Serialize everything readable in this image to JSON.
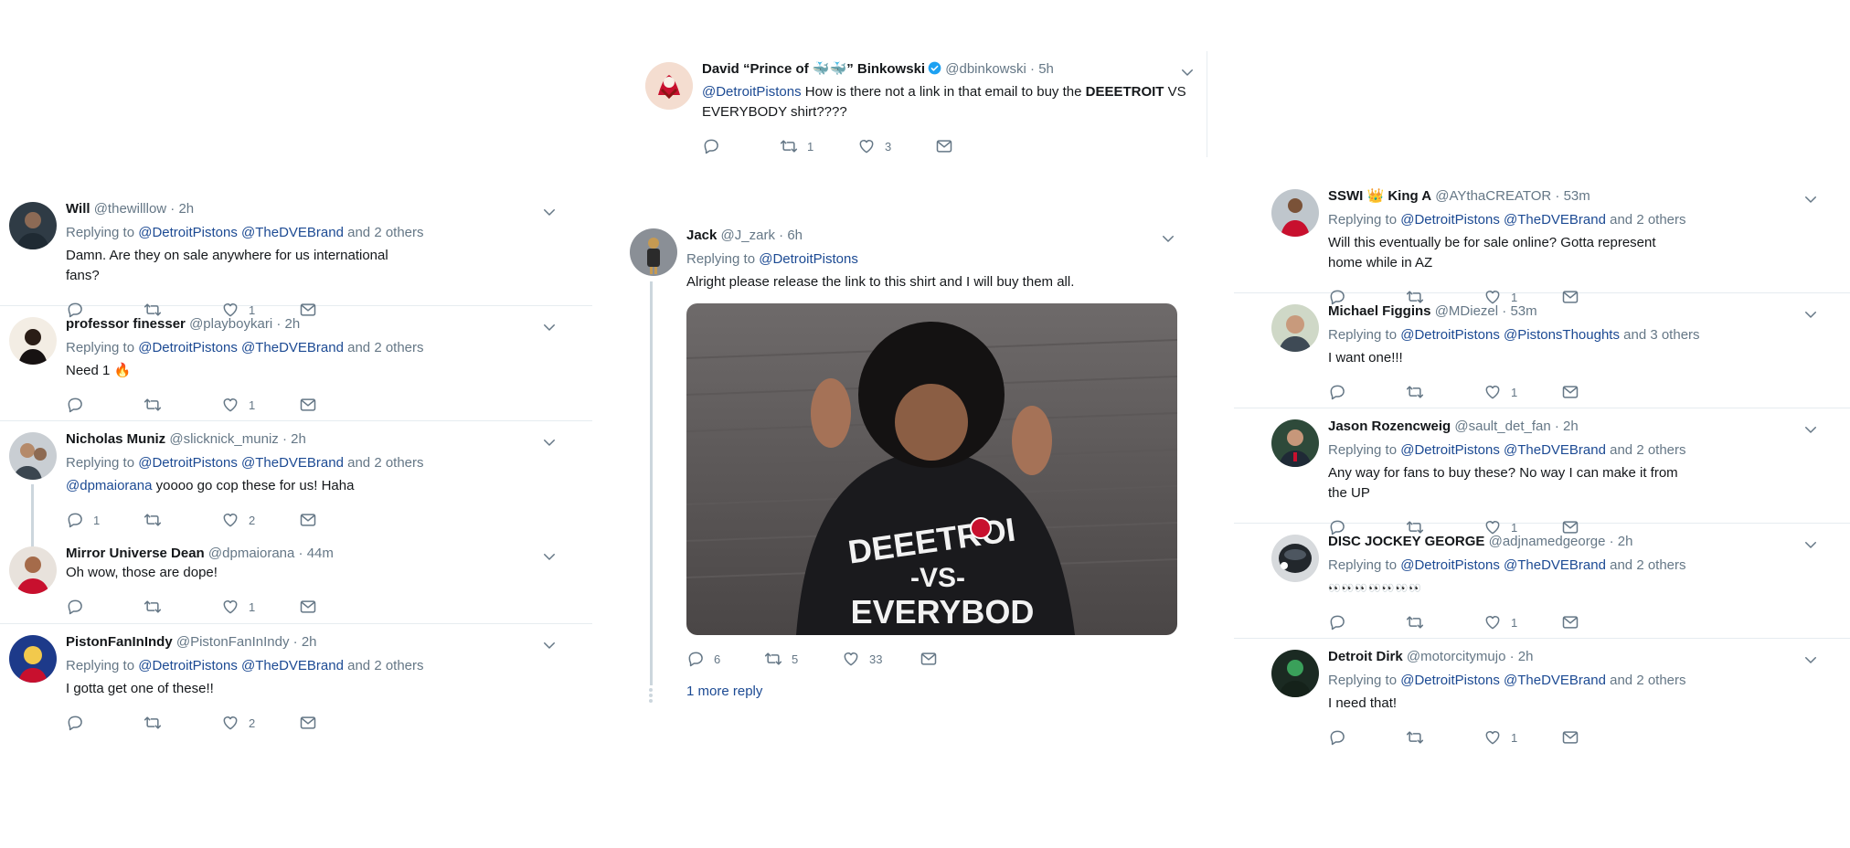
{
  "top_tweet": {
    "name": "David “Prince of 🐳🐳” Binkowski",
    "handle": "@dbinkowski",
    "time": "5h",
    "mention": "@DetroitPistons",
    "text_a": " How is there not a link in that email to buy the ",
    "text_bold": "DEEETROIT",
    "text_b": " VS EVERYBODY shirt????",
    "reply_count": "",
    "retweet_count": "1",
    "like_count": "3"
  },
  "left_column": [
    {
      "name": "Will",
      "handle": "@thewilllow",
      "time": "2h",
      "reply_to_1": "@DetroitPistons",
      "reply_to_2": "@TheDVEBrand",
      "reply_rest": "and 2 others",
      "text": "Damn. Are they on sale anywhere for us international fans?",
      "replies": "",
      "retweets": "",
      "likes": "1"
    },
    {
      "name": "professor finesser",
      "handle": "@playboykari",
      "time": "2h",
      "reply_to_1": "@DetroitPistons",
      "reply_to_2": "@TheDVEBrand",
      "reply_rest": "and 2 others",
      "text": "Need 1 🔥",
      "replies": "",
      "retweets": "",
      "likes": "1"
    },
    {
      "name": "Nicholas Muniz",
      "handle": "@slicknick_muniz",
      "time": "2h",
      "reply_to_1": "@DetroitPistons",
      "reply_to_2": "@TheDVEBrand",
      "reply_rest": "and 2 others",
      "text_mention": "@dpmaiorana",
      "text": " yoooo go cop these for us! Haha",
      "replies": "1",
      "retweets": "",
      "likes": "2"
    },
    {
      "name": "Mirror Universe Dean",
      "handle": "@dpmaiorana",
      "time": "44m",
      "text": "Oh wow, those are dope!",
      "replies": "",
      "retweets": "",
      "likes": "1"
    },
    {
      "name": "PistonFanInIndy",
      "handle": "@PistonFanInIndy",
      "time": "2h",
      "reply_to_1": "@DetroitPistons",
      "reply_to_2": "@TheDVEBrand",
      "reply_rest": "and 2 others",
      "text": "I gotta get one of these!!",
      "replies": "",
      "retweets": "",
      "likes": "2"
    }
  ],
  "center_tweet": {
    "name": "Jack",
    "handle": "@J_zark",
    "time": "6h",
    "reply_to_1": "@DetroitPistons",
    "text": "Alright please release the link to this shirt and I will buy them all.",
    "shirt_text_1": "DEEETROI",
    "shirt_text_2": "-VS-",
    "shirt_text_3": "EVERYBOD",
    "replies": "6",
    "retweets": "5",
    "likes": "33",
    "more_reply": "1 more reply"
  },
  "right_column": [
    {
      "name": "SSWI 👑 King A",
      "handle": "@AYthaCREATOR",
      "time": "53m",
      "reply_to_1": "@DetroitPistons",
      "reply_to_2": "@TheDVEBrand",
      "reply_rest": "and 2 others",
      "text": "Will this eventually be for sale online? Gotta represent home while in AZ",
      "replies": "",
      "retweets": "",
      "likes": "1"
    },
    {
      "name": "Michael Figgins",
      "handle": "@MDiezel",
      "time": "53m",
      "reply_to_1": "@DetroitPistons",
      "reply_to_2": "@PistonsThoughts",
      "reply_rest": "and 3 others",
      "text": "I want one!!!",
      "replies": "",
      "retweets": "",
      "likes": "1"
    },
    {
      "name": "Jason Rozencweig",
      "handle": "@sault_det_fan",
      "time": "2h",
      "reply_to_1": "@DetroitPistons",
      "reply_to_2": "@TheDVEBrand",
      "reply_rest": "and 2 others",
      "text": "Any way for fans to buy these? No way I can make it from the UP",
      "replies": "",
      "retweets": "",
      "likes": "1"
    },
    {
      "name": "DISC JOCKEY GEORGE",
      "handle": "@adjnamedgeorge",
      "time": "2h",
      "reply_to_1": "@DetroitPistons",
      "reply_to_2": "@TheDVEBrand",
      "reply_rest": "and 2 others",
      "text": "👀👀👀👀👀👀👀",
      "replies": "",
      "retweets": "",
      "likes": "1"
    },
    {
      "name": "Detroit Dirk",
      "handle": "@motorcitymujo",
      "time": "2h",
      "reply_to_1": "@DetroitPistons",
      "reply_to_2": "@TheDVEBrand",
      "reply_rest": "and 2 others",
      "text": "I need that!",
      "replies": "",
      "retweets": "",
      "likes": "1"
    }
  ],
  "labels": {
    "replying_to": "Replying to",
    "dot": "·"
  },
  "colors": {
    "mention": "#1c4a93",
    "meta": "#657786",
    "divider": "#e6ecf0",
    "verified": "#1da1f2"
  }
}
